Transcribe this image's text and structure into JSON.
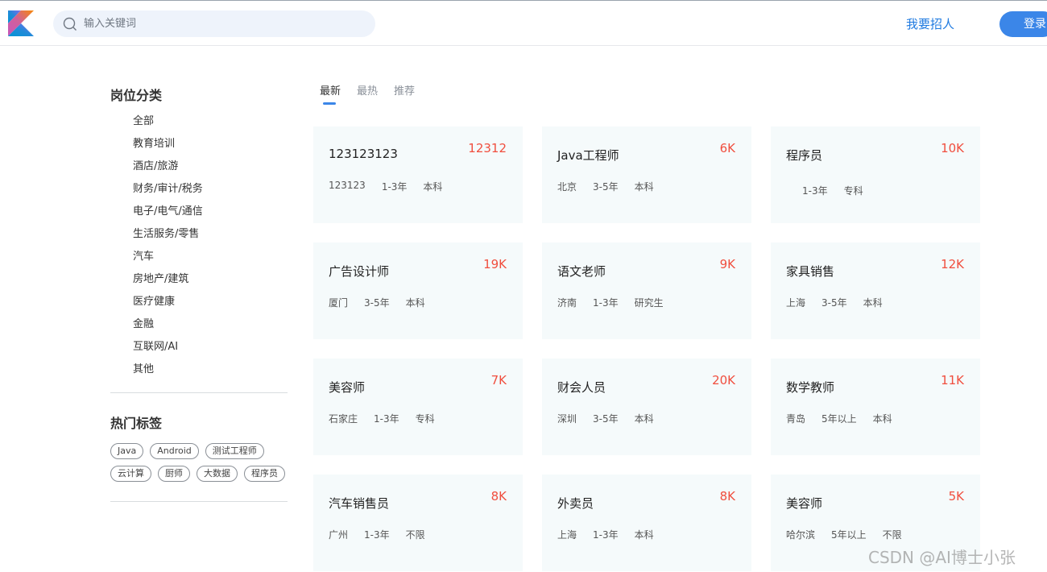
{
  "header": {
    "search_placeholder": "输入关键词",
    "recruit_label": "我要招人",
    "login_label": "登录"
  },
  "sidebar": {
    "category_title": "岗位分类",
    "categories": [
      "全部",
      "教育培训",
      "酒店/旅游",
      "财务/审计/税务",
      "电子/电气/通信",
      "生活服务/零售",
      "汽车",
      "房地产/建筑",
      "医疗健康",
      "金融",
      "互联网/AI",
      "其他"
    ],
    "hot_tags_title": "热门标签",
    "hot_tags": [
      "Java",
      "Android",
      "测试工程师",
      "云计算",
      "厨师",
      "大数据",
      "程序员"
    ]
  },
  "tabs": [
    "最新",
    "最热",
    "推荐"
  ],
  "jobs": [
    {
      "title": "123123123",
      "salary": "12312",
      "city": "123123",
      "experience": "1-3年",
      "education": "本科"
    },
    {
      "title": "Java工程师",
      "salary": "6K",
      "city": "北京",
      "experience": "3-5年",
      "education": "本科"
    },
    {
      "title": "程序员",
      "salary": "10K",
      "city": "",
      "experience": "1-3年",
      "education": "专科"
    },
    {
      "title": "广告设计师",
      "salary": "19K",
      "city": "厦门",
      "experience": "3-5年",
      "education": "本科"
    },
    {
      "title": "语文老师",
      "salary": "9K",
      "city": "济南",
      "experience": "1-3年",
      "education": "研究生"
    },
    {
      "title": "家具销售",
      "salary": "12K",
      "city": "上海",
      "experience": "3-5年",
      "education": "本科"
    },
    {
      "title": "美容师",
      "salary": "7K",
      "city": "石家庄",
      "experience": "1-3年",
      "education": "专科"
    },
    {
      "title": "财会人员",
      "salary": "20K",
      "city": "深圳",
      "experience": "3-5年",
      "education": "本科"
    },
    {
      "title": "数学教师",
      "salary": "11K",
      "city": "青岛",
      "experience": "5年以上",
      "education": "本科"
    },
    {
      "title": "汽车销售员",
      "salary": "8K",
      "city": "广州",
      "experience": "1-3年",
      "education": "不限"
    },
    {
      "title": "外卖员",
      "salary": "8K",
      "city": "上海",
      "experience": "1-3年",
      "education": "本科"
    },
    {
      "title": "美容师",
      "salary": "5K",
      "city": "哈尔滨",
      "experience": "5年以上",
      "education": "不限"
    }
  ],
  "watermark": "CSDN @AI博士小张",
  "colors": {
    "accent": "#3b86e8",
    "salary": "#f04e3e",
    "card_bg": "#f5fafb"
  }
}
